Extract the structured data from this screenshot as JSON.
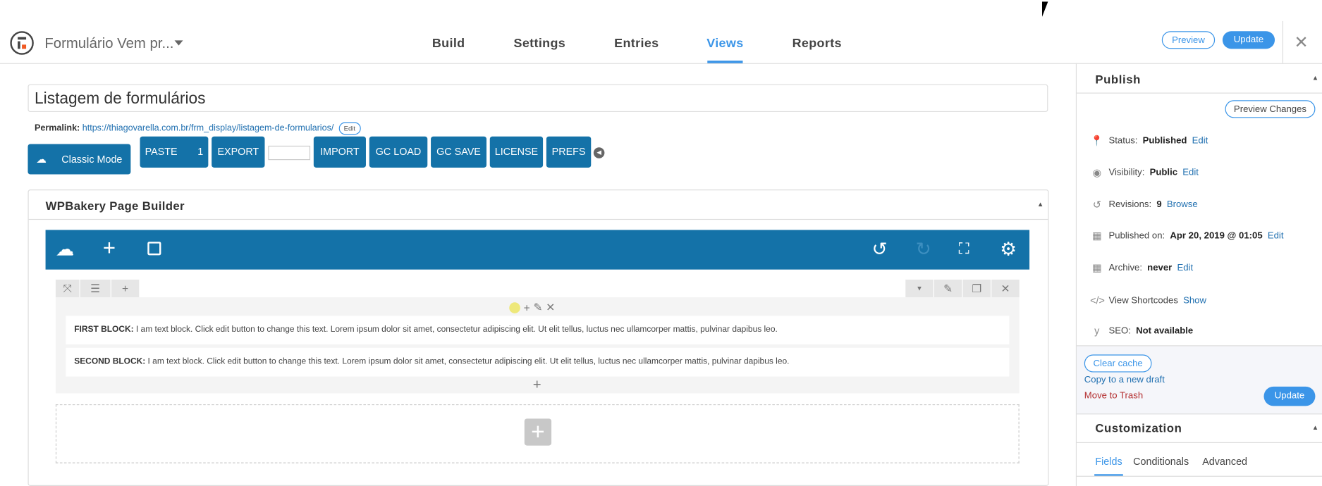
{
  "header": {
    "form_title": "Formulário Vem pr...",
    "nav": [
      "Build",
      "Settings",
      "Entries",
      "Views",
      "Reports"
    ],
    "active_nav": "Views",
    "preview": "Preview",
    "update": "Update"
  },
  "main": {
    "view_title": "Listagem de formulários",
    "permalink_label": "Permalink:",
    "permalink_base": "https://thiagovarella.com.br/frm_display/",
    "permalink_slug": "listagem-de-formularios",
    "permalink_trail": "/",
    "permalink_edit": "Edit",
    "classic_mode": "Classic Mode",
    "toolbar": {
      "paste": "PASTE",
      "paste_count": "1",
      "export": "EXPORT",
      "import": "IMPORT",
      "gc_load": "GC LOAD",
      "gc_save": "GC SAVE",
      "license": "LICENSE",
      "prefs": "PREFS"
    },
    "builder_title": "WPBakery Page Builder",
    "blocks": [
      {
        "label": "FIRST BLOCK:",
        "text": " I am text block. Click edit button to change this text. Lorem ipsum dolor sit amet, consectetur adipiscing elit. Ut elit tellus, luctus nec ullamcorper mattis, pulvinar dapibus leo."
      },
      {
        "label": "SECOND BLOCK:",
        "text": " I am text block. Click edit button to change this text. Lorem ipsum dolor sit amet, consectetur adipiscing elit. Ut elit tellus, luctus nec ullamcorper mattis, pulvinar dapibus leo."
      }
    ]
  },
  "sidebar": {
    "publish_title": "Publish",
    "preview_changes": "Preview Changes",
    "status": {
      "label": "Status:",
      "value": "Published",
      "link": "Edit"
    },
    "visibility": {
      "label": "Visibility:",
      "value": "Public",
      "link": "Edit"
    },
    "revisions": {
      "label": "Revisions:",
      "value": "9",
      "link": "Browse"
    },
    "published_on": {
      "label": "Published on:",
      "value": "Apr 20, 2019 @ 01:05",
      "link": "Edit"
    },
    "archive": {
      "label": "Archive:",
      "value": "never",
      "link": "Edit"
    },
    "shortcodes": {
      "label": "View",
      "value": "Shortcodes",
      "link": "Show"
    },
    "seo": {
      "label": "SEO:",
      "value": "Not available"
    },
    "clear_cache": "Clear cache",
    "copy_draft": "Copy to a new draft",
    "trash": "Move to Trash",
    "update": "Update",
    "customization_title": "Customization",
    "tabs": [
      "Fields",
      "Conditionals",
      "Advanced"
    ],
    "active_tab": "Fields"
  },
  "colors": {
    "accent": "#3b95e8",
    "builder_blue": "#1472a8",
    "trash": "#b32d2e"
  }
}
